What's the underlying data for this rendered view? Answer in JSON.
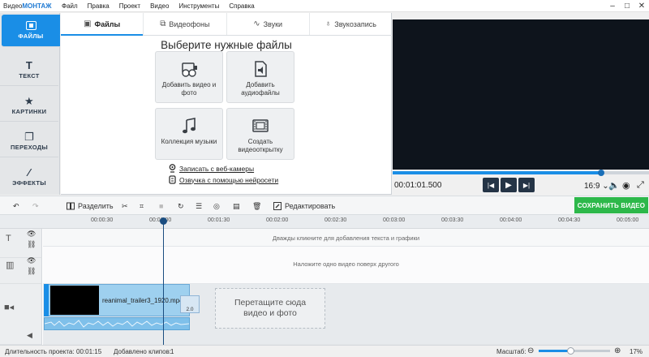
{
  "app": {
    "logo_prefix": "Видео",
    "logo_brand": "МОНТАЖ",
    "menu": [
      "Файл",
      "Правка",
      "Проект",
      "Видео",
      "Инструменты",
      "Справка"
    ]
  },
  "sidebar": {
    "items": [
      {
        "label": "ФАЙЛЫ",
        "icon": "files-icon",
        "active": true
      },
      {
        "label": "ТЕКСТ",
        "icon": "text-icon"
      },
      {
        "label": "КАРТИНКИ",
        "icon": "star-icon"
      },
      {
        "label": "ПЕРЕХОДЫ",
        "icon": "transitions-icon"
      },
      {
        "label": "ЭФФЕКТЫ",
        "icon": "magic-wand-icon"
      }
    ]
  },
  "tabs": [
    {
      "label": "Файлы",
      "icon": "image-icon",
      "active": true
    },
    {
      "label": "Видеофоны",
      "icon": "video-backgrounds-icon"
    },
    {
      "label": "Звуки",
      "icon": "waveform-icon"
    },
    {
      "label": "Звукозапись",
      "icon": "microphone-icon"
    }
  ],
  "files": {
    "title": "Выберите нужные файлы",
    "tiles": [
      {
        "label": "Добавить видео и фото",
        "icon": "film-reel-icon"
      },
      {
        "label": "Добавить аудиофайлы",
        "icon": "audio-file-icon"
      },
      {
        "label": "Коллекция музыки",
        "icon": "music-notes-icon"
      },
      {
        "label": "Создать видеооткрытку",
        "icon": "film-strip-icon"
      }
    ],
    "links": [
      {
        "label": "Записать с веб-камеры",
        "icon": "webcam-icon"
      },
      {
        "label": "Озвучка с помощью нейросети",
        "icon": "ai-voice-icon"
      }
    ]
  },
  "player": {
    "timecode": "00:01:01.500",
    "progress": 0.81,
    "aspect": "16:9",
    "aspect_chevron": "⌄"
  },
  "toolbar": {
    "split": "Разделить",
    "edit": "Редактировать",
    "save": "СОХРАНИТЬ ВИДЕО"
  },
  "ruler": {
    "labels": [
      "00:00:30",
      "00:01:00",
      "00:01:30",
      "00:02:00",
      "00:02:30",
      "00:03:00",
      "00:03:30",
      "00:04:00",
      "00:04:30",
      "00:05:00"
    ]
  },
  "timeline": {
    "text_hint": "Дважды кликните для добавления текста и графики",
    "overlay_hint": "Наложите одно видео поверх другого",
    "clip_name": "reanimal_trailer3_1920.mp4",
    "transition_label": "2.0",
    "drop_zone": "Перетащите сюда видео и фото"
  },
  "status": {
    "duration_label": "Длительность проекта:",
    "duration_value": "00:01:15",
    "clips_label": "Добавлено клипов:",
    "clips_value": "1",
    "scale_label": "Масштаб:",
    "zoom_percent": "17%",
    "zoom_value": 0.45
  },
  "colors": {
    "accent": "#1a8ee6",
    "save": "#2db84a",
    "preview_bg": "#0e141c"
  }
}
